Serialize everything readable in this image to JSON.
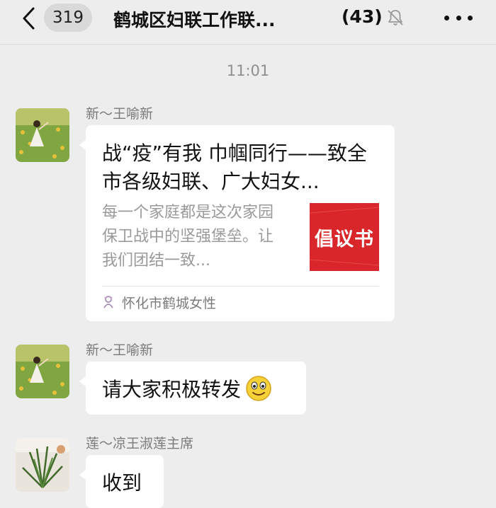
{
  "header": {
    "unread_count": "319",
    "title": "鹤城区妇联工作联...",
    "member_count": "(43)"
  },
  "timestamp": "11:01",
  "messages": [
    {
      "sender": "新～王喻新",
      "type": "link-card",
      "card": {
        "title": "战“疫”有我 巾帼同行——致全市各级妇联、广大妇女...",
        "description": "每一个家庭都是这次家园保卫战中的坚强堡垒。让我们团结一致...",
        "thumbnail_text": "倡议书",
        "source": "怀化市鹤城女性"
      }
    },
    {
      "sender": "新～王喻新",
      "type": "text",
      "text": "请大家积极转发",
      "emoji": "smile-emoji"
    },
    {
      "sender": "莲～凉王淑莲主席",
      "type": "text",
      "text": "收到"
    }
  ],
  "colors": {
    "background": "#ededed",
    "bubble": "#ffffff",
    "thumbnail_red": "#d9262a",
    "secondary_text": "#7b7b7b"
  }
}
